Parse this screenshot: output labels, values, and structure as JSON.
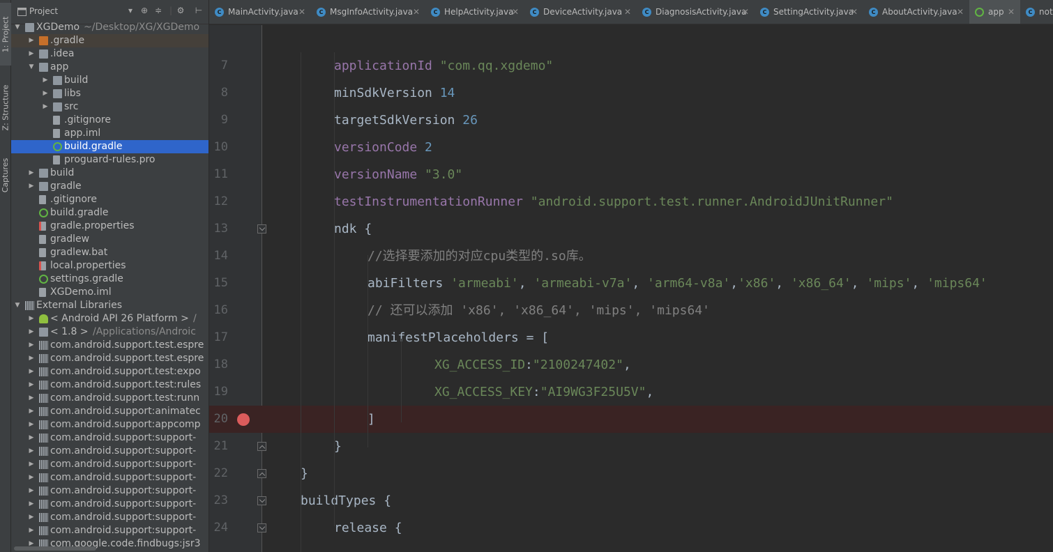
{
  "tool_strip": {
    "project_tab": "1: Project",
    "structure_tab": "Z: Structure",
    "captures_tab": "Captures"
  },
  "project_panel": {
    "title": "Project",
    "tree": [
      {
        "label": "XGDemo",
        "sub": "~/Desktop/XG/XGDemo",
        "depth": 0,
        "arrow": "open",
        "icon": "folder-icon"
      },
      {
        "label": ".gradle",
        "depth": 1,
        "arrow": "closed",
        "icon": "orange-folder-icon"
      },
      {
        "label": ".idea",
        "depth": 1,
        "arrow": "closed",
        "icon": "folder-icon"
      },
      {
        "label": "app",
        "depth": 1,
        "arrow": "open",
        "icon": "folder-icon"
      },
      {
        "label": "build",
        "depth": 2,
        "arrow": "closed",
        "icon": "folder-icon"
      },
      {
        "label": "libs",
        "depth": 2,
        "arrow": "closed",
        "icon": "folder-icon"
      },
      {
        "label": "src",
        "depth": 2,
        "arrow": "closed",
        "icon": "folder-icon"
      },
      {
        "label": ".gitignore",
        "depth": 2,
        "arrow": "",
        "icon": "file-icon"
      },
      {
        "label": "app.iml",
        "depth": 2,
        "arrow": "",
        "icon": "file-icon"
      },
      {
        "label": "build.gradle",
        "depth": 2,
        "arrow": "",
        "icon": "gradle-icon",
        "selected": true
      },
      {
        "label": "proguard-rules.pro",
        "depth": 2,
        "arrow": "",
        "icon": "file-icon"
      },
      {
        "label": "build",
        "depth": 1,
        "arrow": "closed",
        "icon": "folder-icon"
      },
      {
        "label": "gradle",
        "depth": 1,
        "arrow": "closed",
        "icon": "folder-icon"
      },
      {
        "label": ".gitignore",
        "depth": 1,
        "arrow": "",
        "icon": "file-icon"
      },
      {
        "label": "build.gradle",
        "depth": 1,
        "arrow": "",
        "icon": "gradle-icon"
      },
      {
        "label": "gradle.properties",
        "depth": 1,
        "arrow": "",
        "icon": "properties-icon"
      },
      {
        "label": "gradlew",
        "depth": 1,
        "arrow": "",
        "icon": "file-icon"
      },
      {
        "label": "gradlew.bat",
        "depth": 1,
        "arrow": "",
        "icon": "file-icon"
      },
      {
        "label": "local.properties",
        "depth": 1,
        "arrow": "",
        "icon": "properties-icon"
      },
      {
        "label": "settings.gradle",
        "depth": 1,
        "arrow": "",
        "icon": "gradle-icon"
      },
      {
        "label": "XGDemo.iml",
        "depth": 1,
        "arrow": "",
        "icon": "file-icon"
      },
      {
        "label": "External Libraries",
        "depth": 0,
        "arrow": "open",
        "icon": "library-icon"
      },
      {
        "label": "< Android API 26 Platform >",
        "sub": "/",
        "depth": 1,
        "arrow": "closed",
        "icon": "android-icon"
      },
      {
        "label": "< 1.8 >",
        "sub": "/Applications/Androic",
        "depth": 1,
        "arrow": "closed",
        "icon": "jdk-icon"
      },
      {
        "label": "com.android.support.test.espre",
        "depth": 1,
        "arrow": "closed",
        "icon": "library-icon"
      },
      {
        "label": "com.android.support.test.espre",
        "depth": 1,
        "arrow": "closed",
        "icon": "library-icon"
      },
      {
        "label": "com.android.support.test:expo",
        "depth": 1,
        "arrow": "closed",
        "icon": "library-icon"
      },
      {
        "label": "com.android.support.test:rules",
        "depth": 1,
        "arrow": "closed",
        "icon": "library-icon"
      },
      {
        "label": "com.android.support.test:runn",
        "depth": 1,
        "arrow": "closed",
        "icon": "library-icon"
      },
      {
        "label": "com.android.support:animatec",
        "depth": 1,
        "arrow": "closed",
        "icon": "library-icon"
      },
      {
        "label": "com.android.support:appcomp",
        "depth": 1,
        "arrow": "closed",
        "icon": "library-icon"
      },
      {
        "label": "com.android.support:support-",
        "depth": 1,
        "arrow": "closed",
        "icon": "library-icon"
      },
      {
        "label": "com.android.support:support-",
        "depth": 1,
        "arrow": "closed",
        "icon": "library-icon"
      },
      {
        "label": "com.android.support:support-",
        "depth": 1,
        "arrow": "closed",
        "icon": "library-icon"
      },
      {
        "label": "com.android.support:support-",
        "depth": 1,
        "arrow": "closed",
        "icon": "library-icon"
      },
      {
        "label": "com.android.support:support-",
        "depth": 1,
        "arrow": "closed",
        "icon": "library-icon"
      },
      {
        "label": "com.android.support:support-",
        "depth": 1,
        "arrow": "closed",
        "icon": "library-icon"
      },
      {
        "label": "com.android.support:support-",
        "depth": 1,
        "arrow": "closed",
        "icon": "library-icon"
      },
      {
        "label": "com.android.support:support-",
        "depth": 1,
        "arrow": "closed",
        "icon": "library-icon"
      },
      {
        "label": "com.google.code.findbugs:jsr3",
        "depth": 1,
        "arrow": "closed",
        "icon": "library-icon"
      }
    ]
  },
  "tabs": [
    {
      "label": "MainActivity.java",
      "icon": "class-icon"
    },
    {
      "label": "MsgInfoActivity.java",
      "icon": "class-icon"
    },
    {
      "label": "HelpActivity.java",
      "icon": "class-icon"
    },
    {
      "label": "DeviceActivity.java",
      "icon": "class-icon"
    },
    {
      "label": "DiagnosisActivity.java",
      "icon": "class-icon"
    },
    {
      "label": "SettingActivity.java",
      "icon": "class-icon"
    },
    {
      "label": "AboutActivity.java",
      "icon": "class-icon"
    },
    {
      "label": "app",
      "icon": "gradle-icon",
      "active": true
    },
    {
      "label": "noti",
      "icon": "class-icon"
    }
  ],
  "editor": {
    "lines": [
      {
        "num": "7",
        "indent": 2,
        "tokens": [
          {
            "t": "applicationId ",
            "c": "k"
          },
          {
            "t": "\"com.qq.xgdemo\"",
            "c": "s"
          }
        ]
      },
      {
        "num": "8",
        "indent": 2,
        "tokens": [
          {
            "t": "minSdkVersion ",
            "c": "p"
          },
          {
            "t": "14",
            "c": "n"
          }
        ]
      },
      {
        "num": "9",
        "indent": 2,
        "tokens": [
          {
            "t": "targetSdkVersion ",
            "c": "p"
          },
          {
            "t": "26",
            "c": "n"
          }
        ]
      },
      {
        "num": "10",
        "indent": 2,
        "tokens": [
          {
            "t": "versionCode ",
            "c": "k"
          },
          {
            "t": "2",
            "c": "n"
          }
        ]
      },
      {
        "num": "11",
        "indent": 2,
        "tokens": [
          {
            "t": "versionName ",
            "c": "k"
          },
          {
            "t": "\"3.0\"",
            "c": "s"
          }
        ]
      },
      {
        "num": "12",
        "indent": 2,
        "tokens": [
          {
            "t": "testInstrumentationRunner ",
            "c": "k"
          },
          {
            "t": "\"android.support.test.runner.AndroidJUnitRunner\"",
            "c": "s"
          }
        ]
      },
      {
        "num": "13",
        "indent": 2,
        "fold": "up",
        "tokens": [
          {
            "t": "ndk {",
            "c": "p"
          }
        ]
      },
      {
        "num": "14",
        "indent": 3,
        "tokens": [
          {
            "t": "//选择要添加的对应cpu类型的.so库。",
            "c": "c"
          }
        ]
      },
      {
        "num": "15",
        "indent": 3,
        "tokens": [
          {
            "t": "abiFilters ",
            "c": "p"
          },
          {
            "t": "'armeabi'",
            "c": "s"
          },
          {
            "t": ", ",
            "c": "p"
          },
          {
            "t": "'armeabi-v7a'",
            "c": "s"
          },
          {
            "t": ", ",
            "c": "p"
          },
          {
            "t": "'arm64-v8a'",
            "c": "s"
          },
          {
            "t": ",",
            "c": "p"
          },
          {
            "t": "'x86'",
            "c": "s"
          },
          {
            "t": ", ",
            "c": "p"
          },
          {
            "t": "'x86_64'",
            "c": "s"
          },
          {
            "t": ", ",
            "c": "p"
          },
          {
            "t": "'mips'",
            "c": "s"
          },
          {
            "t": ", ",
            "c": "p"
          },
          {
            "t": "'mips64'",
            "c": "s"
          }
        ]
      },
      {
        "num": "16",
        "indent": 3,
        "tokens": [
          {
            "t": "// 还可以添加 'x86', 'x86_64', 'mips', 'mips64'",
            "c": "c"
          }
        ]
      },
      {
        "num": "17",
        "indent": 3,
        "tokens": [
          {
            "t": "manifestPlaceholders = [",
            "c": "p"
          }
        ]
      },
      {
        "num": "18",
        "indent": 5,
        "tokens": [
          {
            "t": "XG_ACCESS_ID",
            "c": "s"
          },
          {
            "t": ":",
            "c": "p"
          },
          {
            "t": "\"2100247402\"",
            "c": "s"
          },
          {
            "t": ",",
            "c": "p"
          }
        ]
      },
      {
        "num": "19",
        "indent": 5,
        "tokens": [
          {
            "t": "XG_ACCESS_KEY",
            "c": "s"
          },
          {
            "t": ":",
            "c": "p"
          },
          {
            "t": "\"AI9WG3F25U5V\"",
            "c": "s"
          },
          {
            "t": ",",
            "c": "p"
          }
        ]
      },
      {
        "num": "20",
        "indent": 3,
        "breakpoint": true,
        "tokens": [
          {
            "t": "]",
            "c": "p"
          }
        ]
      },
      {
        "num": "21",
        "indent": 2,
        "fold": "down",
        "tokens": [
          {
            "t": "}",
            "c": "p"
          }
        ]
      },
      {
        "num": "22",
        "indent": 1,
        "fold": "down",
        "tokens": [
          {
            "t": "}",
            "c": "p"
          }
        ]
      },
      {
        "num": "23",
        "indent": 1,
        "fold": "up",
        "tokens": [
          {
            "t": "buildTypes {",
            "c": "p"
          }
        ]
      },
      {
        "num": "24",
        "indent": 2,
        "fold": "up",
        "tokens": [
          {
            "t": "release {",
            "c": "p"
          }
        ]
      }
    ]
  },
  "colors": {
    "keyword": "#9876aa",
    "string": "#6a8759",
    "number": "#6897bb",
    "comment": "#808080",
    "plain": "#a9b7c6",
    "selection": "#2f65ca",
    "breakpoint": "#db5c5c"
  }
}
